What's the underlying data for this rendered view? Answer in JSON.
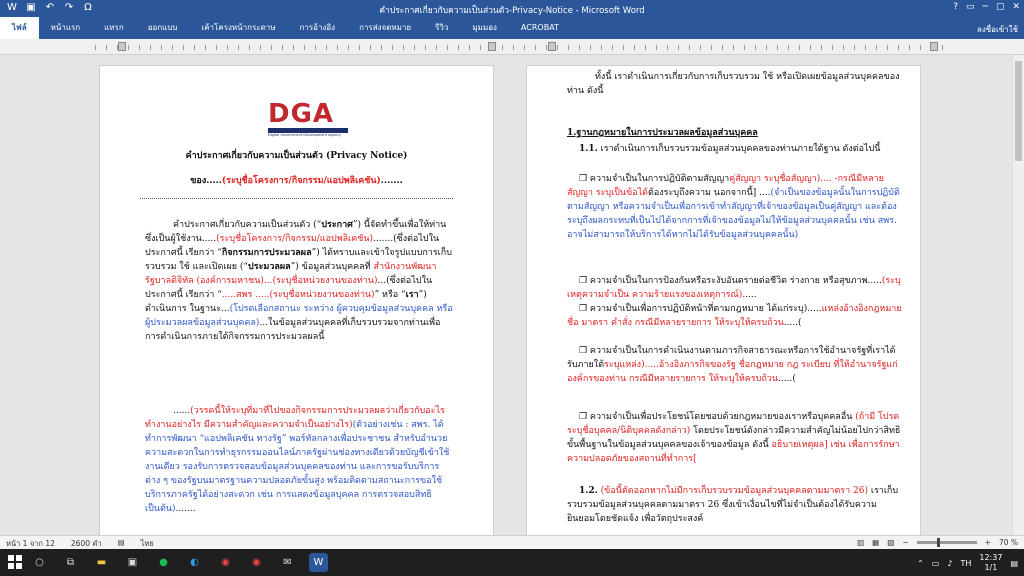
{
  "window": {
    "title": "คำประกาศเกี่ยวกับความเป็นส่วนตัว-Privacy-Notice - Microsoft Word",
    "qat_icons": [
      "word-icon",
      "save-icon",
      "undo-icon",
      "redo-icon",
      "symbol-icon"
    ],
    "symbol_label": "Ω",
    "controls": [
      "?",
      "▭",
      "─",
      "▢",
      "✕"
    ]
  },
  "ribbon": {
    "tabs": [
      "ไฟล์",
      "หน้าแรก",
      "แทรก",
      "ออกแบบ",
      "เค้าโครงหน้ากระดาษ",
      "การอ้างอิง",
      "การส่งจดหมาย",
      "รีวิว",
      "มุมมอง",
      "ACROBAT"
    ],
    "account": "ลงชื่อเข้าใช้"
  },
  "doc_left": {
    "logo": "DGA",
    "logo_tagline": "Digital Government Development Agency",
    "title": "คำประกาศเกี่ยวกับความเป็นส่วนตัว (Privacy Notice)",
    "sub_prefix": "ของ.....",
    "sub_red": "(ระบุชื่อโครงการ/กิจกรรม/แอปพลิเคชัน)",
    "sub_suffix": ".......",
    "separator": "--------------------------------------------------------------------------------",
    "p1_a": "คำประกาศเกี่ยวกับความเป็นส่วนตัว (“",
    "p1_b": "ประกาศ",
    "p1_c": "”) นี้จัดทำขึ้นเพื่อให้ท่านซึ่งเป็นผู้ใช้งาน.....",
    "p1_red1": "(ระบุชื่อโครงการ/กิจกรรม/แอปพลิเคชัน)",
    "p1_d": ".......(ซึ่งต่อไปในประกาศนี้ เรียกว่า “",
    "p1_e": "กิจกรรมการประมวลผล",
    "p1_f": "”) ได้ทราบและเข้าใจรูปแบบการเก็บรวบรวม ใช้ และเปิดเผย (“",
    "p1_g": "ประมวลผล",
    "p1_h": "”) ข้อมูลส่วนบุคคลที่ ",
    "p1_red2": "สำนักงานพัฒนารัฐบาลดิจิทัล (องค์การมหาชน)...(ระบุชื่อหน่วยงานของท่าน)",
    "p1_i": "...(ซึ่งต่อไปในประกาศนี้ เรียกว่า “",
    "p1_red3": ".....สพร .....(ระบุชื่อหน่วยงานของท่าน)",
    "p1_j": "” หรือ “",
    "p1_k": "เรา",
    "p1_l": "”) ดำเนินการ ในฐานะ...",
    "p1_blue": "(โปรดเลือกสถานะ ระหว่าง ผู้ควบคุมข้อมูลส่วนบุคคล หรือ ผู้ประมวลผลข้อมูลส่วนบุคคล)",
    "p1_m": "...ในข้อมูลส่วนบุคคลที่เก็บรวบรวมจากท่านเพื่อการดำเนินการภายใต้กิจกรรมการประมวลผลนี้",
    "p2_a": "......",
    "p2_red": "(วรรคนี้ให้ระบุที่มาที่ไปของกิจกรรมการประมวลผลว่าเกี่ยวกับอะไร ทำงานอย่างไร มีความสำคัญและความจำเป็นอย่างไร)",
    "p2_blue": "(ตัวอย่างเช่น : สพร. ได้ทำการพัฒนา “แอปพลิเคชัน ทางรัฐ” พอร์ทัลกลางเพื่อประชาชน สำหรับอำนวยความสะดวกในการทำธุรกรรมออนไลน์ภาครัฐผ่านช่องทางเดียวด้วยบัญชีเข้าใช้งานเดียว รองรับการตรวจสอบข้อมูลส่วนบุคคลของท่าน และการขอรับบริการต่าง ๆ ของรัฐบนมาตรฐานความปลอดภัยขั้นสูง พร้อมติดตามสถานะการขอใช้บริการภาครัฐได้อย่างสะดวก เช่น การแสดงข้อมูลบุคคล การตรวจสอบสิทธิเป็นต้น)",
    "p2_b": "......."
  },
  "doc_right": {
    "intro": "ทั้งนี้ เราดำเนินการเกี่ยวกับการเก็บรวบรวม ใช้ หรือเปิดเผยข้อมูลส่วนบุคคลของท่าน ดังนี้",
    "h1": "1.ฐานกฎหมายในการประมวลผลข้อมูลส่วนบุคคล",
    "s11_num": "1.1.",
    "s11": "เราดำเนินการเก็บรวบรวมข้อมูลส่วนบุคคลของท่านภายใต้ฐาน ดังต่อไปนี้",
    "b1_a": "❒ ความจำเป็นในการปฏิบัติตามสัญญา",
    "b1_red": "คู่สัญญา ระบุชื่อสัญญา).... -กรณีมีหลายสัญญา ระบุเป็นข้อได้",
    "b1_b": "ต้องระบุถึงความ นอกจากนี้] ....",
    "b1_blue": "(จำเป็นของข้อมูลนั้นในการปฏิบัติตามสัญญา หรือความจำเป็นเพื่อการเข้าทำสัญญาที่เจ้าของข้อมูลเป็นคู่สัญญา และต้องระบุถึงผลกระทบที่เป็นไปได้จากการที่เจ้าของข้อมูลไม่ให้ข้อมูลส่วนบุคคลนั้น เช่น สพร. อาจไม่สามารถให้บริการได้หากไม่ได้รับข้อมูลส่วนบุคคลนั้น)",
    "b2_a": "❒ ความจำเป็นในการป้องกันหรือระงับอันตรายต่อชีวิต ร่างกาย หรือสุขภาพ.....",
    "b2_red": "(ระบุเหตุความจำเป็น ความร้ายแรงของเหตุการณ์)",
    "b2_b": ".....",
    "b3_a": "❒ ความจำเป็นเพื่อการปฏิบัติหน้าที่ตามกฎหมาย ได้แก่ระบุ).....",
    "b3_red": "แหล่งอ้างอิงกฎหมาย ชื่อ มาตรา คำสั่ง กรณีมีหลายรายการ ให้ระบุให้ครบถ้วน",
    "b3_b": ".....(",
    "b4_a": "❒ ความจำเป็นในการดำเนินงานตามภารกิจสาธารณะหรือการใช้อำนาจรัฐที่เราได้รับภายใต้",
    "b4_red": "ระบุแหล่ง).....อ้างอิงภารกิจของรัฐ ชื่อกฎหมาย กฎ ระเบียบ ที่ให้อำนาจรัฐแก่องค์กรของท่าน กรณีมีหลายรายการ ให้ระบุให้ครบถ้วน",
    "b4_b": ".....(",
    "b5_a": "❒ ความจำเป็นเพื่อประโยชน์โดยชอบด้วยกฎหมายของเราหรือบุคคลอื่น ",
    "b5_red1": "(ถ้ามี โปรดระบุชื่อบุคคล/นิติบุคคลดังกล่าว)",
    "b5_b": " โดยประโยชน์ดังกล่าวมีความสำคัญไม่น้อยไปกว่าสิทธิขั้นพื้นฐานในข้อมูลส่วนบุคคลของเจ้าของข้อมูล ดังนี้ ",
    "b5_red2": "อธิบายเหตุผล] เช่น เพื่อการรักษาความปลอดภัยของสถานที่ทำการ[",
    "s12_num": "1.2.",
    "s12_red": "(ข้อนี้ตัดออกหากไม่มีการเก็บรวบรวมข้อมูลส่วนบุคคลตามมาตรา 26)",
    "s12": " เราเก็บรวบรวมข้อมูลส่วนบุคคลตามมาตรา 26 ซึ่งเข้าเงื่อนไขที่ไม่จำเป็นต้องได้รับความยินยอมโดยชัดแจ้ง เพื่อวัตถุประสงค์"
  },
  "status": {
    "page": "หน้า 1 จาก 12",
    "words": "2600 คำ",
    "lang": "ไทย",
    "zoom": "70 %"
  },
  "taskbar": {
    "lang": "TH",
    "time": "12:37",
    "date": "1/1"
  }
}
